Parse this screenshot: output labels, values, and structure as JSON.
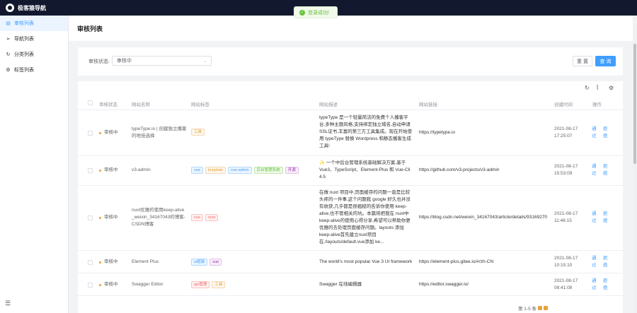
{
  "app": {
    "title": "极客猿导航"
  },
  "toast": {
    "message": "登录成功!"
  },
  "sidebar": {
    "items": [
      {
        "label": "审核列表",
        "icon": "document-icon",
        "active": true
      },
      {
        "label": "导航列表",
        "icon": "send-icon",
        "active": false
      },
      {
        "label": "分类列表",
        "icon": "refresh-icon",
        "active": false
      },
      {
        "label": "标签列表",
        "icon": "gear-icon",
        "active": false
      }
    ]
  },
  "page": {
    "title": "审核列表"
  },
  "filter": {
    "label": "审核状态:",
    "selected": "审核中",
    "reset_label": "重 置",
    "search_label": "查 询"
  },
  "table": {
    "columns": [
      "审核状态",
      "网站名称",
      "网站标签",
      "网站描述",
      "网站链接",
      "创建时间",
      "操作"
    ],
    "rows": [
      {
        "status": "审核中",
        "name": "typeType.io | 创建独立播客的地佳选择",
        "tags": [
          {
            "text": "工具",
            "color": "orange"
          }
        ],
        "desc": "typeType 是一个轻量简洁的免费个人播客平台,多种主题风格,支持绑定独立域名,自动申请SSL证书,丰富的第三方工具集成。现在开始使用 typeType 替换 Wordpress 和静态播客生成工具!",
        "url": "https://typetype.io",
        "date": "2021-08-17",
        "time": "17:25:07",
        "approve": "通过",
        "reject": "拒绝"
      },
      {
        "status": "审核中",
        "name": "v3-admin",
        "tags": [
          {
            "text": "vue",
            "color": "cyan"
          },
          {
            "text": "template",
            "color": "orange"
          },
          {
            "text": "vue-admin",
            "color": "cyan"
          },
          {
            "text": "后台管理系统",
            "color": "green"
          },
          {
            "text": "开源",
            "color": "purple"
          }
        ],
        "desc": "✨ 一个中后台管理系统基础解决方案,基于 Vue3、TypeScript、Element-Plus 和 Vue-Cli 4.5",
        "url": "https://github.com/v3-projects/v3-admin",
        "date": "2021-08-17",
        "time": "15:53:09",
        "approve": "通过",
        "reject": "拒绝"
      },
      {
        "status": "审核中",
        "name": "nuxt优雅的使用keep-alive_weixin_34167043的博客-CSDN博客",
        "tags": [
          {
            "text": "vue",
            "color": "red"
          },
          {
            "text": "nuxt",
            "color": "red"
          }
        ],
        "desc": "在做 nuxt 项目中,页面缓存的问题一直是比较头疼的一件事,这个问题我 google 好久也并没有收获,几乎都是很粗糙的告诉你使用 keep-alive,也不管相关的坑。本篇将把我在 nuxt中keep-alive的使用心得分享,希望可以帮助你更优雅的去处理页面缓存问题。layouts 添加 keep-alive首先建立nuxt项目在./layouts/default.vue添加 ke...",
        "url": "https://blog.csdn.net/weixin_34167043/article/details/93169270",
        "date": "2021-08-17",
        "time": "11:46:15",
        "approve": "通过",
        "reject": "拒绝"
      },
      {
        "status": "审核中",
        "name": "Element Plus",
        "tags": [
          {
            "text": "ui框架",
            "color": "cyan"
          },
          {
            "text": "vue",
            "color": "purple"
          }
        ],
        "desc": "The world's most popular Vue 3 UI framework",
        "url": "https://element-plus.gitee.io/#/zh-CN",
        "date": "2021-08-17",
        "time": "10:15:10",
        "approve": "通过",
        "reject": "拒绝"
      },
      {
        "status": "审核中",
        "name": "Swagger Editor",
        "tags": [
          {
            "text": "api管理",
            "color": "red"
          },
          {
            "text": "工具",
            "color": "orange"
          }
        ],
        "desc": "Swagger 在线编辑器",
        "url": "https://editor.swagger.io/",
        "date": "2021-08-17",
        "time": "08:41:08",
        "approve": "通过",
        "reject": "拒绝"
      }
    ]
  },
  "pagination": {
    "summary": "第 1-5 条"
  },
  "colors": {
    "primary": "#409eff",
    "topbar": "#12192e",
    "success": "#67c23a",
    "warning": "#e6a23c"
  },
  "toolbar_icons": [
    "refresh-icon",
    "column-height-icon",
    "settings-icon"
  ]
}
